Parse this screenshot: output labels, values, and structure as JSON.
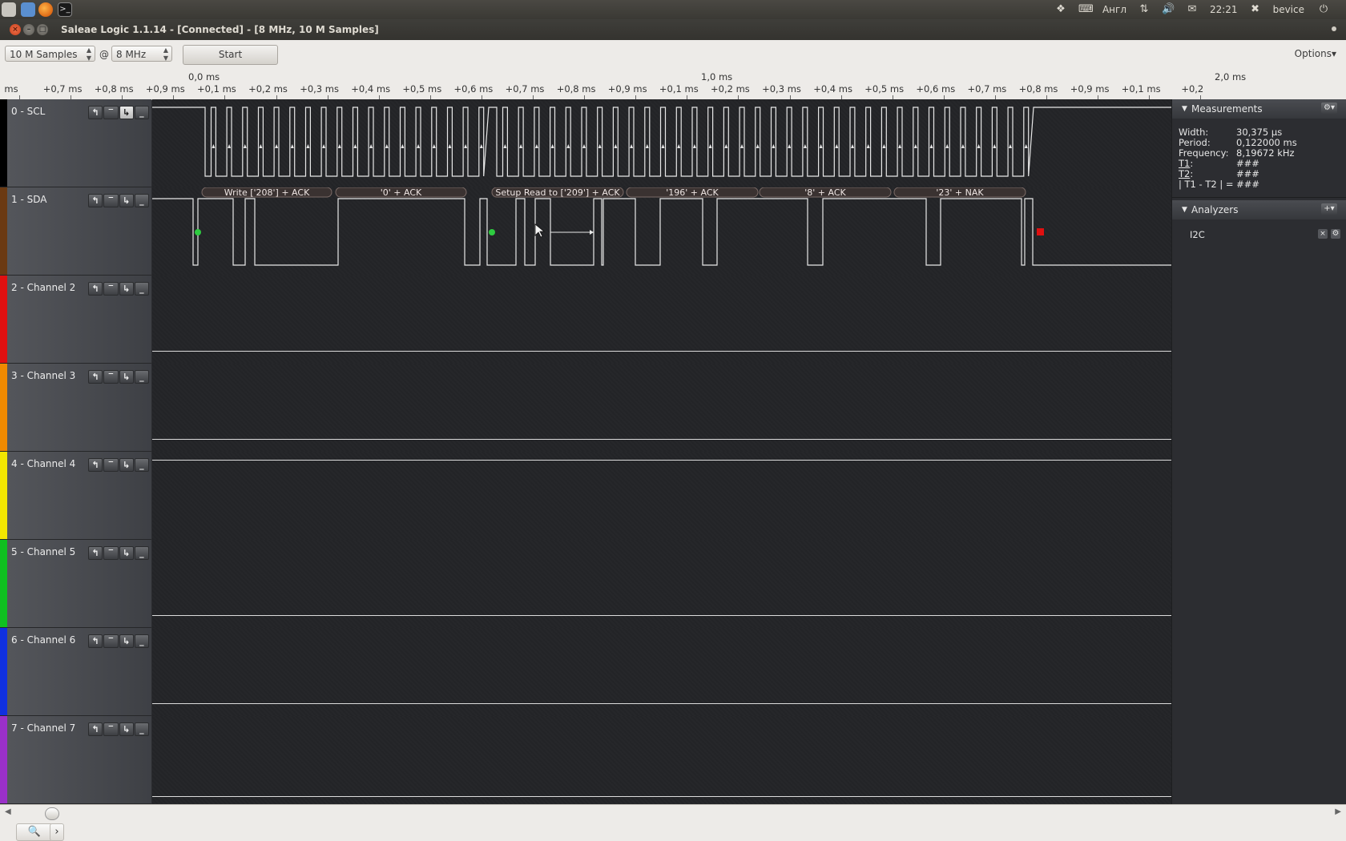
{
  "system_bar": {
    "keyboard_layout": "Англ",
    "time": "22:21",
    "user": "bevice"
  },
  "window": {
    "title": "Saleae Logic 1.1.14 - [Connected] - [8 MHz, 10 M Samples]"
  },
  "toolbar": {
    "samples": "10 M Samples",
    "at": "@",
    "rate": "8 MHz",
    "start_label": "Start",
    "options_label": "Options▾"
  },
  "ruler": {
    "major_labels": [
      "0,0 ms",
      "1,0 ms",
      "2,0 ms"
    ],
    "tick_labels": [
      "ms",
      "+0,7 ms",
      "+0,8 ms",
      "+0,9 ms",
      "+0,1 ms",
      "+0,2 ms",
      "+0,3 ms",
      "+0,4 ms",
      "+0,5 ms",
      "+0,6 ms",
      "+0,7 ms",
      "+0,8 ms",
      "+0,9 ms",
      "+0,1 ms",
      "+0,2 ms",
      "+0,3 ms",
      "+0,4 ms",
      "+0,5 ms",
      "+0,6 ms",
      "+0,7 ms",
      "+0,8 ms",
      "+0,9 ms",
      "+0,1 ms",
      "+0,2"
    ]
  },
  "channels": [
    {
      "label": "0 - SCL",
      "color": "#000000"
    },
    {
      "label": "1 - SDA",
      "color": "#6b3a12"
    },
    {
      "label": "2 - Channel 2",
      "color": "#e01010"
    },
    {
      "label": "3 - Channel 3",
      "color": "#f08a00"
    },
    {
      "label": "4 - Channel 4",
      "color": "#f2e600"
    },
    {
      "label": "5 - Channel 5",
      "color": "#10c020"
    },
    {
      "label": "6 - Channel 6",
      "color": "#1030e0"
    },
    {
      "label": "7 - Channel 7",
      "color": "#9a30c8"
    }
  ],
  "decode_bubbles": [
    "Write ['208'] + ACK",
    "'0' + ACK",
    "Setup Read to ['209'] + ACK",
    "'196' + ACK",
    "'8' + ACK",
    "'23' + NAK"
  ],
  "measurements": {
    "title": "Measurements",
    "width_label": "Width:",
    "width": "30,375 µs",
    "period_label": "Period:",
    "period": "0,122000 ms",
    "frequency_label": "Frequency:",
    "frequency": "8,19672 kHz",
    "t1_label": "T1",
    "t1": "###",
    "t2_label": "T2",
    "t2": "###",
    "diff_label": "| T1 - T2 | =",
    "diff": "###"
  },
  "analyzers": {
    "title": "Analyzers",
    "items": [
      {
        "name": "I2C"
      }
    ]
  },
  "colors": {
    "waveform": "#e8e8e8",
    "start_marker": "#2ecc40",
    "stop_marker": "#e01010"
  }
}
